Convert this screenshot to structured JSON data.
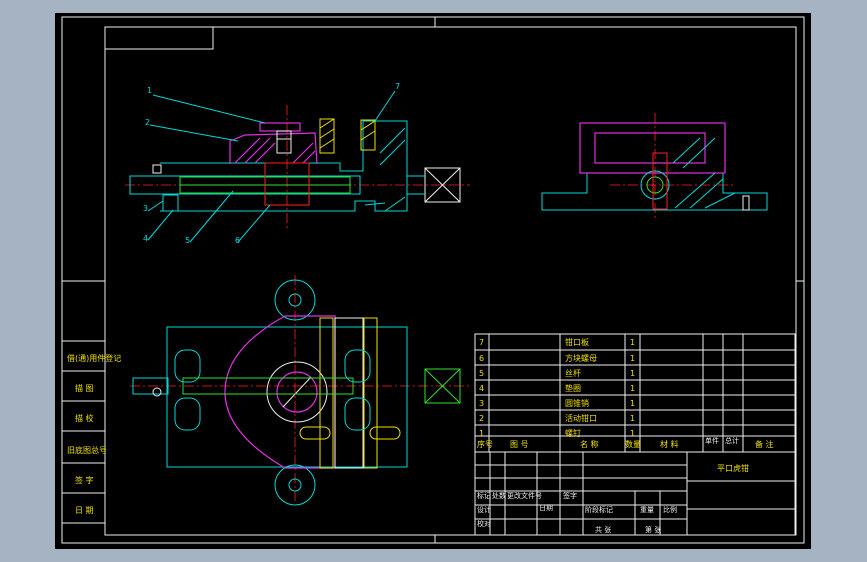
{
  "colors": {
    "background": "#a5b3c3",
    "sheet": "#000000",
    "cyan": "#00d8d8",
    "magenta": "#e030e0",
    "green": "#30e030",
    "yellow": "#f0e000",
    "red": "#ff2020"
  },
  "balloons": [
    "1",
    "2",
    "3",
    "4",
    "5",
    "6",
    "7"
  ],
  "side_labels": [
    "借(通)用件登记",
    "描 图",
    "描 校",
    "旧底图总号",
    "签 字",
    "日 期"
  ],
  "parts_list": {
    "rows": [
      {
        "no": "7",
        "code": "钳口板",
        "name": "钳口板",
        "qty": "1"
      },
      {
        "no": "6",
        "code": "方块螺母",
        "name": "方块螺母",
        "qty": "1"
      },
      {
        "no": "5",
        "code": "丝杆",
        "name": "丝杆",
        "qty": "1"
      },
      {
        "no": "4",
        "code": "垫圈",
        "name": "垫圈",
        "qty": "1"
      },
      {
        "no": "3",
        "code": "圆锥销",
        "name": "圆锥销",
        "qty": "1"
      },
      {
        "no": "2",
        "code": "活动钳口",
        "name": "活动钳口",
        "qty": "1"
      },
      {
        "no": "1",
        "code": "螺钉",
        "name": "螺钉",
        "qty": "1"
      }
    ],
    "header": [
      "序号",
      "图 号",
      "名 称",
      "数量",
      "材 料",
      "单件",
      "总计",
      "备 注"
    ]
  },
  "title_block": {
    "drawing_title": "平口虎钳",
    "labels": [
      "标记",
      "处数",
      "更改文件号",
      "签字",
      "日期",
      "设计",
      "校对",
      "审核",
      "批准",
      "标准化",
      "阶段标记",
      "重量",
      "比例",
      "共 张",
      "第 张"
    ]
  }
}
